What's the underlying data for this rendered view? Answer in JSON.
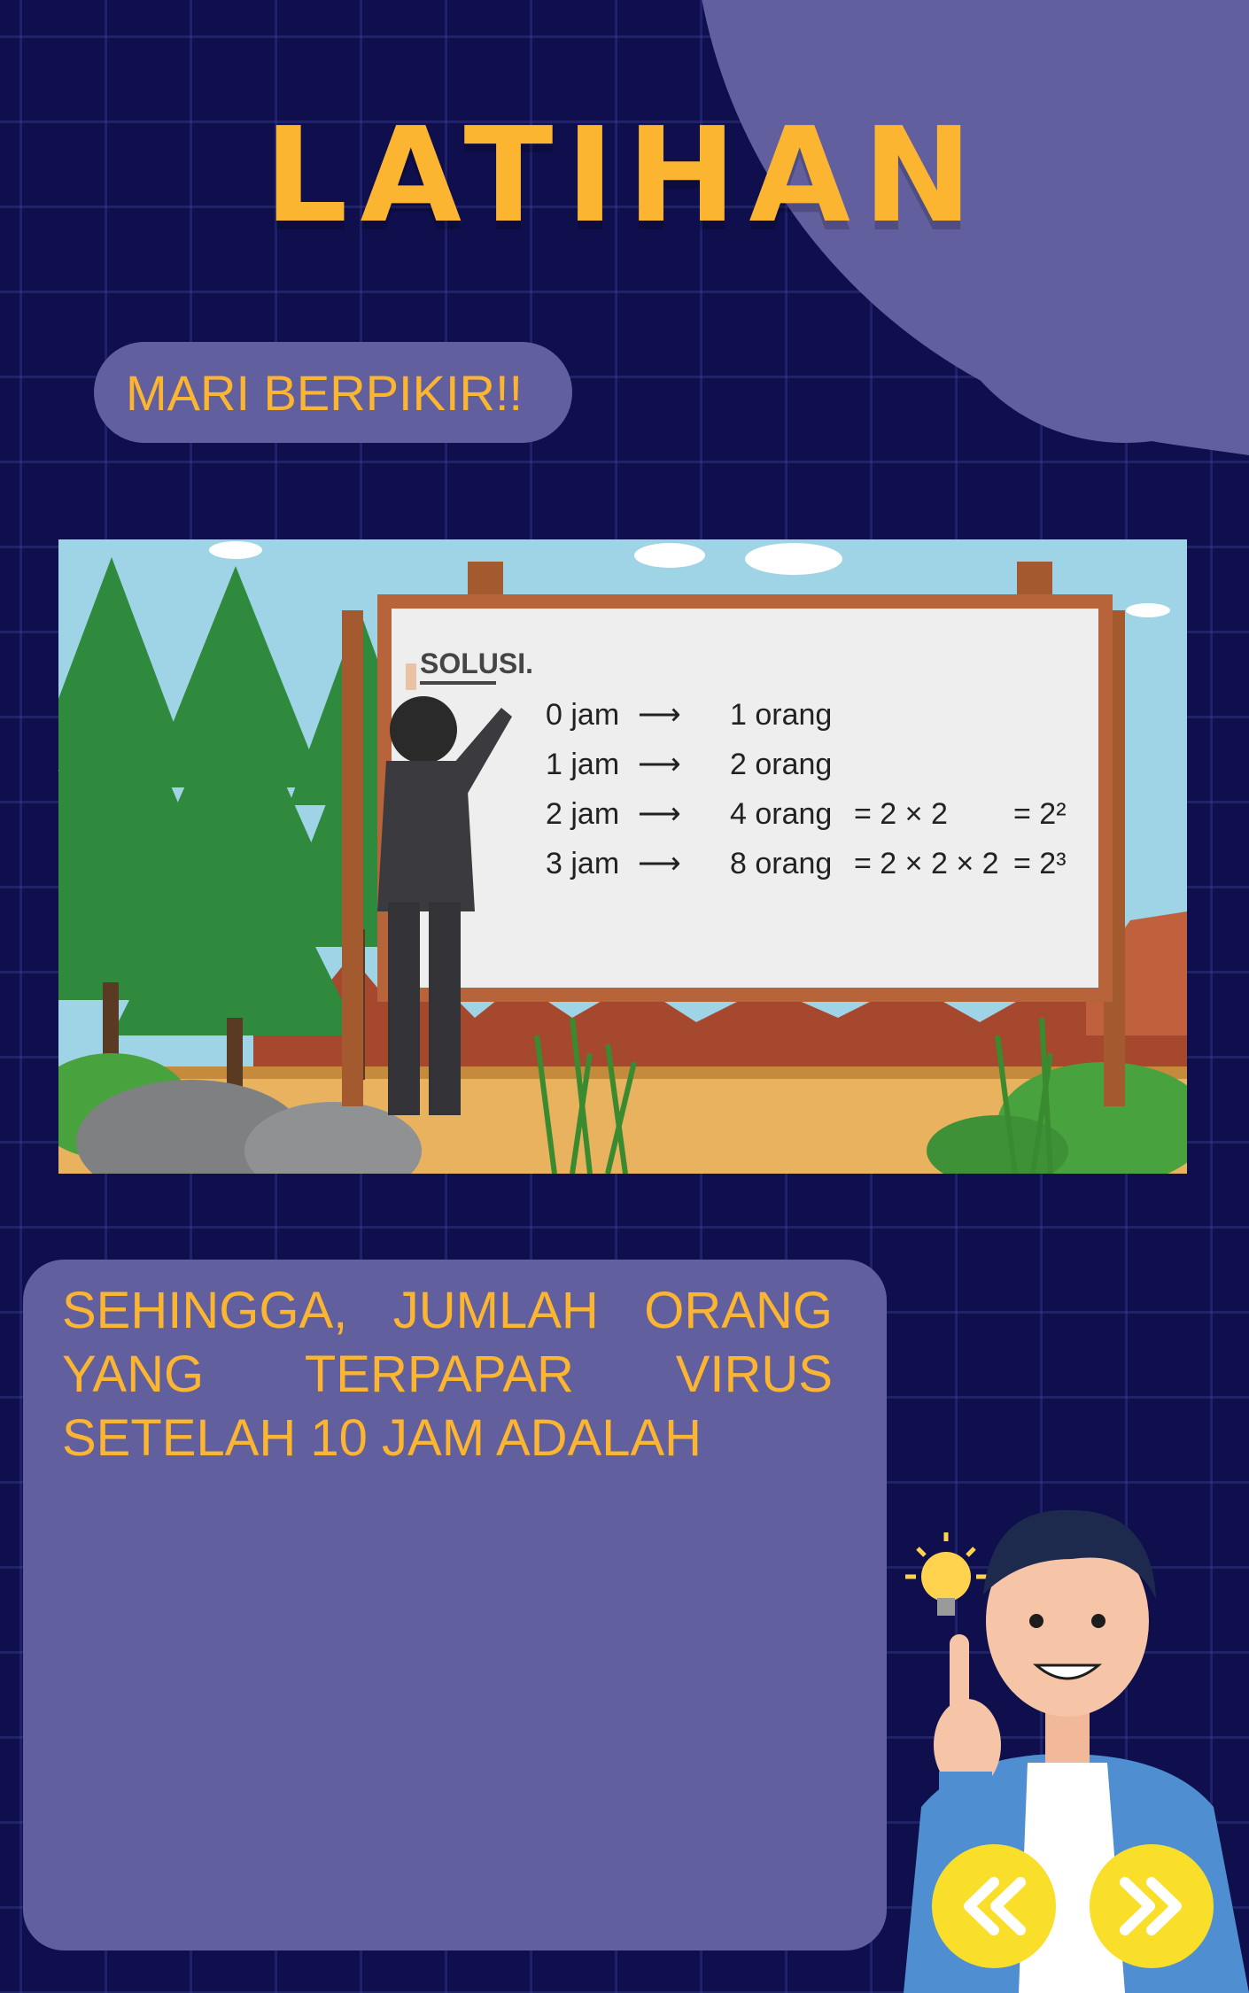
{
  "page": {
    "title": "LATIHAN",
    "subtitle_pill": "MARI BERPIKIR!!",
    "question": "SEHINGGA, JUMLAH ORANG YANG TERPAPAR VIRUS SETELAH 10 JAM ADALAH"
  },
  "board": {
    "heading": "SOLUSI.",
    "rows": [
      {
        "time": "0  jam",
        "people": "1 orang",
        "expr": "",
        "result": ""
      },
      {
        "time": "1  jam",
        "people": "2 orang",
        "expr": "",
        "result": ""
      },
      {
        "time": "2  jam",
        "people": "4 orang",
        "expr": "= 2 × 2",
        "result": "= 2²"
      },
      {
        "time": "3  jam",
        "people": "8 orang",
        "expr": "= 2 × 2 × 2",
        "result": "= 2³"
      }
    ]
  },
  "nav": {
    "prev_icon": "double-chevron-left-icon",
    "next_icon": "double-chevron-right-icon"
  },
  "colors": {
    "background": "#0f0f4d",
    "accent_purple": "#625f9f",
    "title_orange": "#fbb531",
    "button_yellow": "#f9df2a"
  }
}
